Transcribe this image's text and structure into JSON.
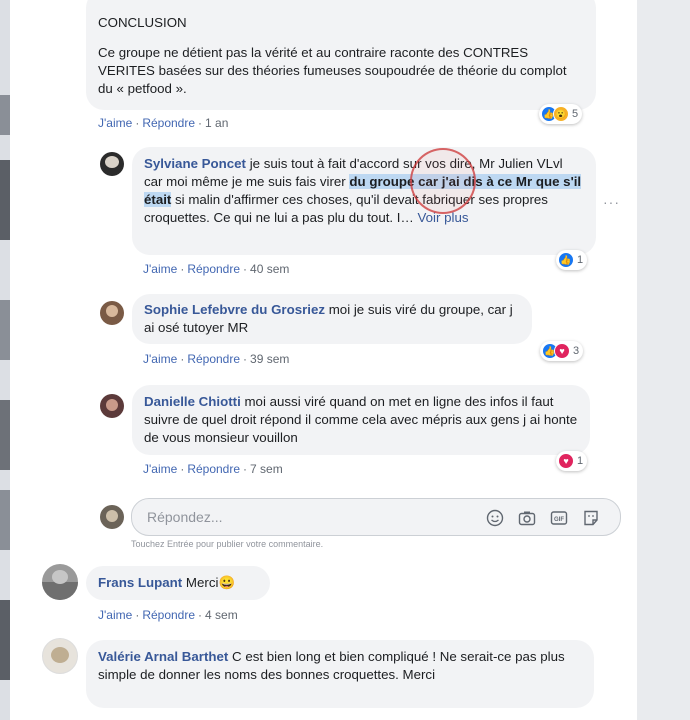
{
  "top_comment": {
    "conclusion": "CONCLUSION",
    "text": "Ce groupe ne détient pas la vérité et au contraire raconte des CONTRES VERITES basées sur des théories fumeuses soupoudrée de théorie du complot du « petfood ».",
    "like": "J'aime",
    "reply": "Répondre",
    "time": "1 an",
    "reaction_count": "5"
  },
  "replies": [
    {
      "name": "Sylviane Poncet",
      "text_before": "je suis tout à fait d'accord sur vos dire, Mr Julien VLvl car moi même je me suis fais virer ",
      "text_highlight": "du groupe car j'ai dis à ce Mr que s'il était",
      "text_after": " si malin d'affirmer ces choses, qu'il devait fabriquer ses propres croquettes. Ce qui ne lui a pas plu du tout. I…",
      "see_more": "Voir plus",
      "like": "J'aime",
      "reply": "Répondre",
      "time": "40 sem",
      "reaction_count": "1"
    },
    {
      "name": "Sophie Lefebvre du Grosriez",
      "text": "moi je suis viré du groupe, car j ai osé tutoyer MR",
      "like": "J'aime",
      "reply": "Répondre",
      "time": "39 sem",
      "reaction_count": "3"
    },
    {
      "name": "Danielle Chiotti",
      "text": "moi aussi viré quand on met en ligne des infos il faut suivre de quel droit répond il comme cela avec mépris aux gens j ai honte de vous monsieur vouillon",
      "like": "J'aime",
      "reply": "Répondre",
      "time": "7 sem",
      "reaction_count": "1"
    }
  ],
  "reply_box": {
    "placeholder": "Répondez...",
    "hint": "Touchez Entrée pour publier votre commentaire."
  },
  "comments": [
    {
      "name": "Frans Lupant",
      "text": "Merci",
      "emoji": "😀",
      "like": "J'aime",
      "reply": "Répondre",
      "time": "4 sem"
    },
    {
      "name": "Valérie Arnal Barthet",
      "text": "C est bien long et bien compliqué ! Ne serait-ce pas plus simple de donner les noms des bonnes croquettes. Merci"
    }
  ],
  "icons": [
    "like-icon",
    "wow-icon",
    "love-icon",
    "sad-icon",
    "emoji-icon",
    "camera-icon",
    "gif-icon",
    "sticker-icon",
    "more-options-icon"
  ],
  "colors": {
    "link": "#385898",
    "action": "#4267b2",
    "bubble": "#f2f3f5",
    "like": "#1877f2",
    "love": "#e0245e"
  }
}
